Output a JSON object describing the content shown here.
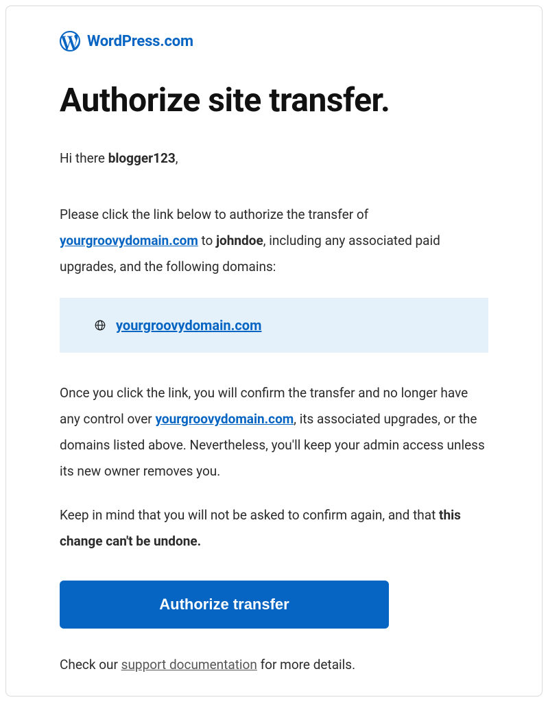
{
  "brand": {
    "name": "WordPress.com"
  },
  "title": "Authorize site transfer.",
  "greeting": {
    "pre": "Hi there ",
    "username": "blogger123",
    "post": ","
  },
  "p1": {
    "pre": "Please click the link below to authorize the transfer of ",
    "site_link": "yourgroovydomain.com",
    "mid1": " to ",
    "recipient": "johndoe",
    "post": ", including any associated paid upgrades, and the following domains:"
  },
  "domain_box": {
    "domain": "yourgroovydomain.com"
  },
  "p2": {
    "pre": "Once you click the link, you will confirm the transfer and no longer have any control over ",
    "site_link": "yourgroovydomain.com",
    "post": ", its associated upgrades, or the domains listed above. Nevertheless, you'll keep your admin access unless its new owner removes you."
  },
  "p3": {
    "pre": "Keep in mind that you will not be asked to confirm again, and that ",
    "emph": "this change can't be undone."
  },
  "cta": {
    "label": "Authorize transfer"
  },
  "footer": {
    "pre": "Check our ",
    "link": "support documentation",
    "post": " for more details."
  }
}
